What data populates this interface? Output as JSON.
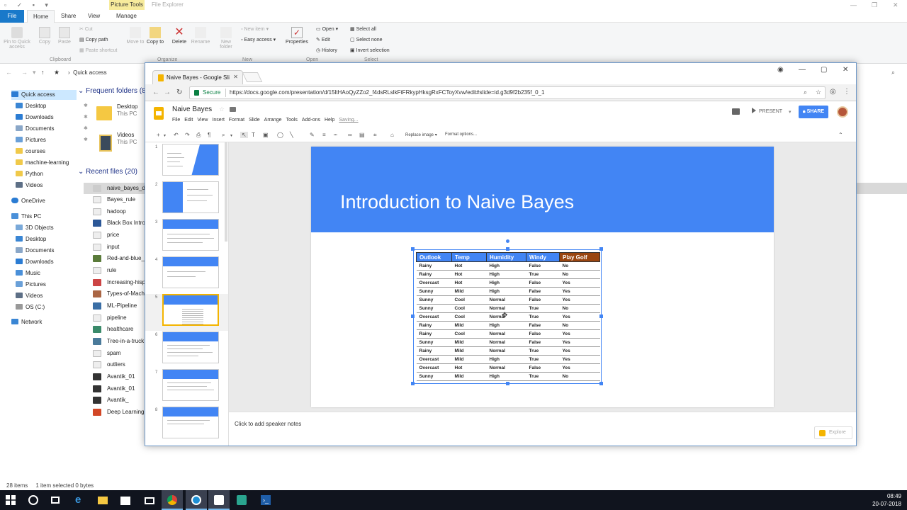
{
  "explorer": {
    "title": "File Explorer",
    "context_tab": "Picture Tools",
    "tabs": [
      {
        "label": "File"
      },
      {
        "label": "Home"
      },
      {
        "label": "Share"
      },
      {
        "label": "View"
      },
      {
        "label": "Manage"
      }
    ],
    "ribbon": {
      "pin": "Pin to Quick access",
      "copy": "Copy",
      "paste": "Paste",
      "cut": "Cut",
      "copy_path": "Copy path",
      "paste_shortcut": "Paste shortcut",
      "clipboard_group": "Clipboard",
      "move_to": "Move to",
      "copy_to": "Copy to",
      "delete": "Delete",
      "rename": "Rename",
      "new_folder": "New folder",
      "new_item": "New item",
      "easy_access": "Easy access",
      "organize_group": "Organize",
      "new_group": "New",
      "properties": "Properties",
      "open": "Open",
      "edit": "Edit",
      "history": "History",
      "open_group": "Open",
      "select_all": "Select all",
      "select_none": "Select none",
      "invert_selection": "Invert selection",
      "select_group": "Select"
    },
    "address": {
      "path": "Quick access"
    },
    "nav_pane": [
      {
        "label": "Quick access"
      },
      {
        "label": "Desktop"
      },
      {
        "label": "Downloads"
      },
      {
        "label": "Documents"
      },
      {
        "label": "Pictures"
      },
      {
        "label": "courses"
      },
      {
        "label": "machine-learning"
      },
      {
        "label": "Python"
      },
      {
        "label": "Videos"
      },
      {
        "label": "OneDrive"
      },
      {
        "label": "This PC"
      },
      {
        "label": "3D Objects"
      },
      {
        "label": "Desktop"
      },
      {
        "label": "Documents"
      },
      {
        "label": "Downloads"
      },
      {
        "label": "Music"
      },
      {
        "label": "Pictures"
      },
      {
        "label": "Videos"
      },
      {
        "label": "OS (C:)"
      },
      {
        "label": "Network"
      }
    ],
    "frequent_header": "Frequent folders (8",
    "frequent": [
      {
        "name": "Desktop",
        "location": "This PC"
      },
      {
        "name": "Videos",
        "location": "This PC"
      }
    ],
    "recent_header": "Recent files (20)",
    "recent": [
      {
        "name": "naive_bayes_da"
      },
      {
        "name": "Bayes_rule"
      },
      {
        "name": "hadoop"
      },
      {
        "name": "Black Box Intro"
      },
      {
        "name": "price"
      },
      {
        "name": "input"
      },
      {
        "name": "Red-and-blue_"
      },
      {
        "name": "rule"
      },
      {
        "name": "Increasing-hisp"
      },
      {
        "name": "Types-of-Mach"
      },
      {
        "name": "ML-Pipeline"
      },
      {
        "name": "pipeline"
      },
      {
        "name": "healthcare"
      },
      {
        "name": "Tree-in-a-truck"
      },
      {
        "name": "spam"
      },
      {
        "name": "outliers"
      },
      {
        "name": "Avantik_01"
      },
      {
        "name": "Avantik_01"
      },
      {
        "name": "Avantik_"
      },
      {
        "name": "Deep Learning"
      }
    ],
    "status": {
      "items": "28 items",
      "selected": "1 item selected  0 bytes"
    }
  },
  "chrome": {
    "tab_title": "Naive Bayes - Google Sli",
    "secure_label": "Secure",
    "url": "https://docs.google.com/presentation/d/15ltHAoQyZZo2_f4dsRLslkFtFRkypHksgRxFCToyXvw/edit#slide=id.g3d9f2b235f_0_1"
  },
  "slides": {
    "doc_title": "Naive Bayes",
    "menus": [
      {
        "label": "File"
      },
      {
        "label": "Edit"
      },
      {
        "label": "View"
      },
      {
        "label": "Insert"
      },
      {
        "label": "Format"
      },
      {
        "label": "Slide"
      },
      {
        "label": "Arrange"
      },
      {
        "label": "Tools"
      },
      {
        "label": "Add-ons"
      },
      {
        "label": "Help"
      }
    ],
    "saving": "Saving...",
    "present": "PRESENT",
    "share": "SHARE",
    "replace_image": "Replace image",
    "format_options": "Format options...",
    "thumbnails": [
      {
        "num": "1"
      },
      {
        "num": "2"
      },
      {
        "num": "3"
      },
      {
        "num": "4"
      },
      {
        "num": "5"
      },
      {
        "num": "6"
      },
      {
        "num": "7"
      },
      {
        "num": "8"
      }
    ],
    "current_slide": {
      "title": "Introduction to Naive Bayes",
      "table": {
        "headers": [
          "Outlook",
          "Temp",
          "Humidity",
          "Windy",
          "Play Golf"
        ],
        "rows": [
          [
            "Rainy",
            "Hot",
            "High",
            "False",
            "No"
          ],
          [
            "Rainy",
            "Hot",
            "High",
            "True",
            "No"
          ],
          [
            "Overcast",
            "Hot",
            "High",
            "False",
            "Yes"
          ],
          [
            "Sunny",
            "Mild",
            "High",
            "False",
            "Yes"
          ],
          [
            "Sunny",
            "Cool",
            "Normal",
            "False",
            "Yes"
          ],
          [
            "Sunny",
            "Cool",
            "Normal",
            "True",
            "No"
          ],
          [
            "Overcast",
            "Cool",
            "Normal",
            "True",
            "Yes"
          ],
          [
            "Rainy",
            "Mild",
            "High",
            "False",
            "No"
          ],
          [
            "Rainy",
            "Cool",
            "Normal",
            "False",
            "Yes"
          ],
          [
            "Sunny",
            "Mild",
            "Normal",
            "False",
            "Yes"
          ],
          [
            "Rainy",
            "Mild",
            "Normal",
            "True",
            "Yes"
          ],
          [
            "Overcast",
            "Mild",
            "High",
            "True",
            "Yes"
          ],
          [
            "Overcast",
            "Hot",
            "Normal",
            "False",
            "Yes"
          ],
          [
            "Sunny",
            "Mild",
            "High",
            "True",
            "No"
          ]
        ]
      }
    },
    "speaker_notes": "Click to add speaker notes",
    "explore": "Explore"
  },
  "taskbar": {
    "time": "08:49",
    "date": "20-07-2018"
  },
  "colors": {
    "accent": "#4285f4",
    "golf_header": "#994510",
    "slides_yellow": "#f4b400"
  }
}
